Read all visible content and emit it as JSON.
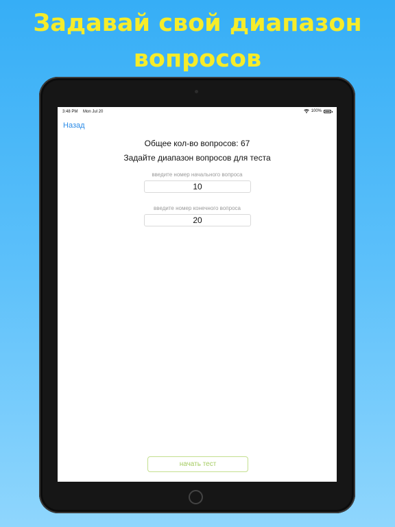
{
  "promo": {
    "headline": "Задавай свой диапазон вопросов"
  },
  "status_bar": {
    "time": "3:48 PM",
    "date": "Mon Jul 20",
    "battery": "100%",
    "wifi_icon": "wifi-icon",
    "battery_icon": "battery-icon"
  },
  "nav": {
    "back_label": "Назад"
  },
  "main": {
    "total_questions": "Общее кол-во вопросов: 67",
    "instruction": "Задайте диапазон вопросов для теста",
    "start_field": {
      "caption": "введите номер начального вопроса",
      "value": "10"
    },
    "end_field": {
      "caption": "введите номер конечного вопроса",
      "value": "20"
    },
    "start_button_label": "начать тест"
  },
  "colors": {
    "background_top": "#36aef6",
    "headline": "#f6ec2a",
    "link": "#2b8be7",
    "button_text": "#a6cc63",
    "button_border": "#c3df8e"
  }
}
